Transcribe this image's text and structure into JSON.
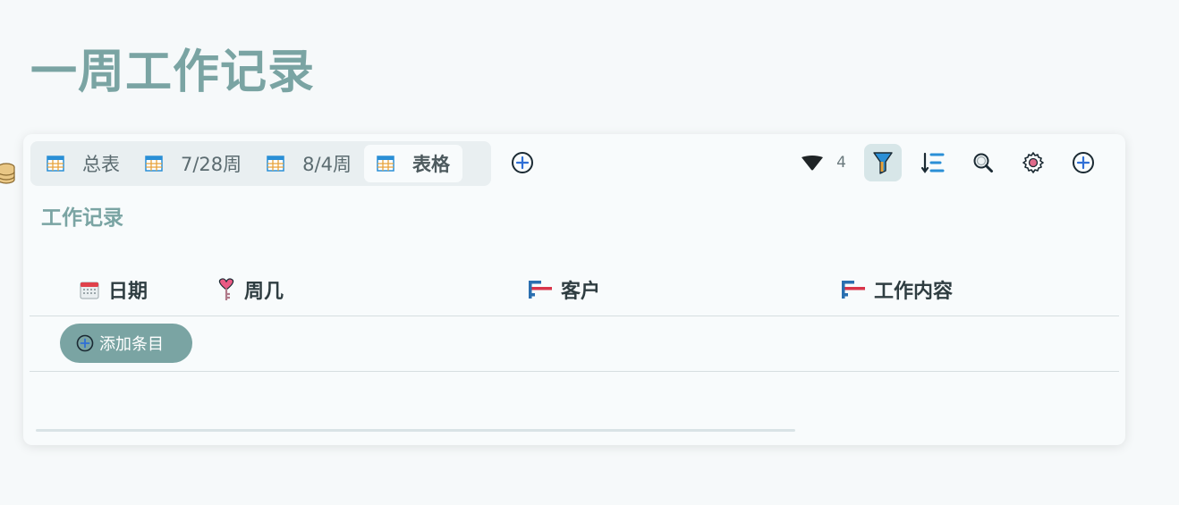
{
  "page": {
    "title": "一周工作记录"
  },
  "views": {
    "tabs": [
      {
        "label": "总表",
        "active": false
      },
      {
        "label": "7/28周",
        "active": false
      },
      {
        "label": "8/4周",
        "active": false
      },
      {
        "label": "表格",
        "active": true
      }
    ]
  },
  "toolbar": {
    "count": "4"
  },
  "section": {
    "title": "工作记录"
  },
  "table": {
    "columns": [
      {
        "label": "日期",
        "icon": "calendar-icon"
      },
      {
        "label": "周几",
        "icon": "key-icon"
      },
      {
        "label": "客户",
        "icon": "text-field-icon"
      },
      {
        "label": "工作内容",
        "icon": "text-field-icon"
      }
    ],
    "add_entry_label": "添加条目"
  },
  "colors": {
    "accent": "#7aa4a3",
    "title": "#7aa4a3",
    "plus": "#2f6fd6"
  }
}
